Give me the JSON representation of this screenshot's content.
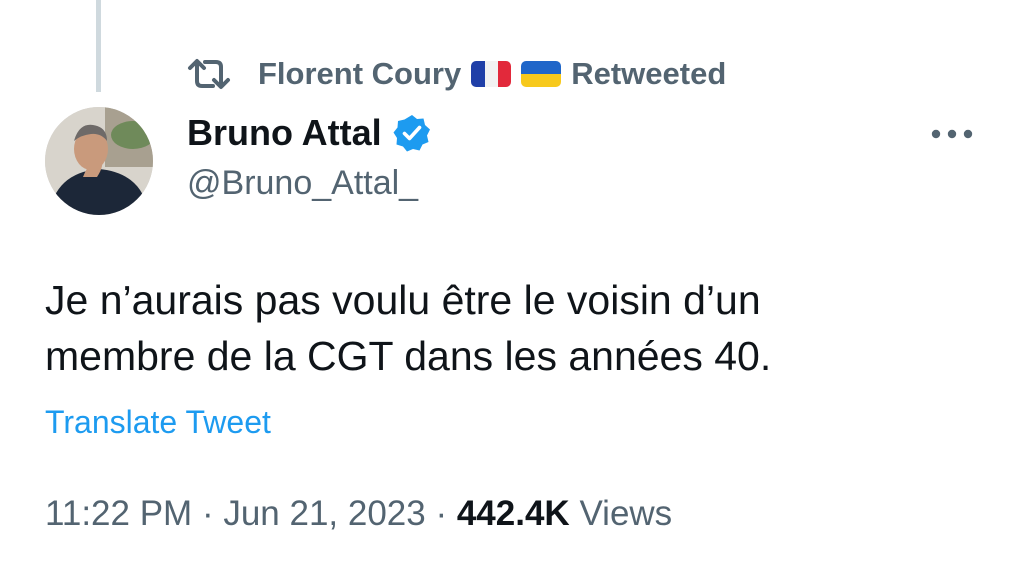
{
  "retweet": {
    "icon": "retweet-icon",
    "retweeter_name": "Florent Coury",
    "flags": [
      "france-flag",
      "ukraine-flag"
    ],
    "label": "Retweeted"
  },
  "author": {
    "avatar": "avatar",
    "display_name": "Bruno Attal",
    "verified": true,
    "verified_icon": "verified-badge-icon",
    "handle": "@Bruno_Attal_"
  },
  "menu": {
    "icon": "more-options-icon"
  },
  "tweet": {
    "text_line_1": "Je n’aurais pas voulu être le voisin d’un",
    "text_line_2": "membre de la CGT dans les années 40.",
    "translate_label": "Translate Tweet"
  },
  "meta": {
    "time": "11:22 PM",
    "separator": " · ",
    "date": "Jun 21, 2023",
    "views_count": "442.4K",
    "views_label": "Views"
  },
  "colors": {
    "text_primary": "#0f1419",
    "text_secondary": "#536471",
    "link": "#1d9bf0",
    "verified": "#1d9bf0",
    "thread_line": "#cfd9de"
  }
}
